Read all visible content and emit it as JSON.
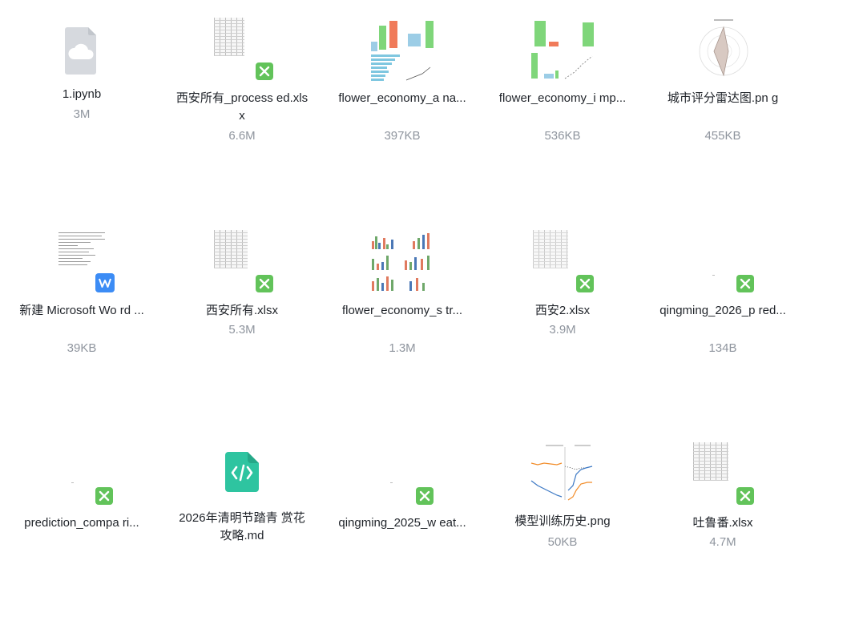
{
  "files": [
    {
      "name": "1.ipynb",
      "size": "3M",
      "icon": "cloud-file-icon"
    },
    {
      "name": "西安所有_process ed.xlsx",
      "size": "6.6M",
      "icon": "excel-icon"
    },
    {
      "name": "flower_economy_a na...",
      "size": "397KB",
      "icon": "chart-thumbnail"
    },
    {
      "name": "flower_economy_i mp...",
      "size": "536KB",
      "icon": "chart-thumbnail"
    },
    {
      "name": "城市评分雷达图.pn g",
      "size": "455KB",
      "icon": "radar-thumbnail"
    },
    {
      "name": "新建 Microsoft Wo rd ...",
      "size": "39KB",
      "icon": "word-icon"
    },
    {
      "name": "西安所有.xlsx",
      "size": "5.3M",
      "icon": "excel-icon"
    },
    {
      "name": "flower_economy_s tr...",
      "size": "1.3M",
      "icon": "chart-thumbnail"
    },
    {
      "name": "西安2.xlsx",
      "size": "3.9M",
      "icon": "excel-icon"
    },
    {
      "name": "qingming_2026_p red...",
      "size": "134B",
      "icon": "excel-icon"
    },
    {
      "name": "prediction_compa ri...",
      "size": "",
      "icon": "excel-icon"
    },
    {
      "name": "2026年清明节踏青 赏花攻略.md",
      "size": "",
      "icon": "markdown-icon"
    },
    {
      "name": "qingming_2025_w eat...",
      "size": "",
      "icon": "excel-icon"
    },
    {
      "name": "模型训练历史.png",
      "size": "50KB",
      "icon": "line-chart-thumbnail"
    },
    {
      "name": "吐鲁番.xlsx",
      "size": "4.7M",
      "icon": "excel-icon"
    }
  ],
  "colors": {
    "excel_badge": "#62c35a",
    "word_badge": "#3c8cf5",
    "markdown": "#2ec4a0",
    "size_text": "#8f959e"
  }
}
